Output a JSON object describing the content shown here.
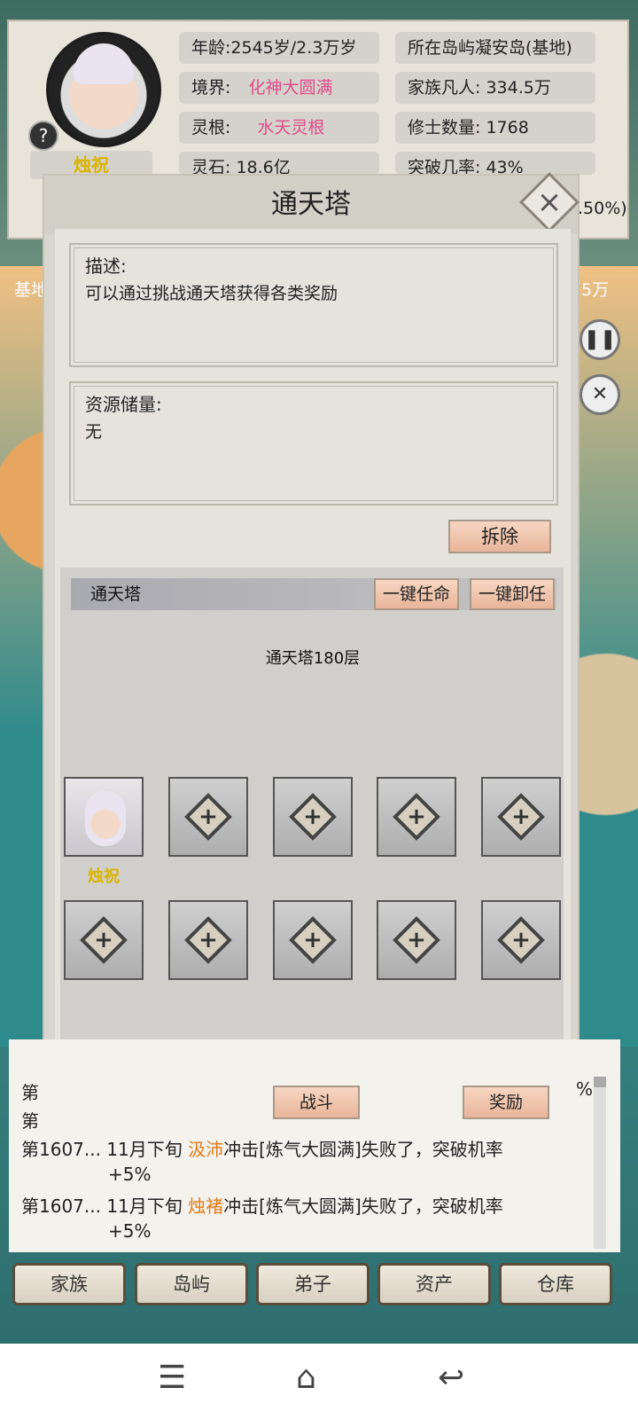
{
  "top": {
    "char_name": "烛祝",
    "help_icon": "?",
    "age": "年龄:2545岁/2.3万岁",
    "realm_label": "境界:",
    "realm_value": "化神大圆满",
    "root_label": "灵根:",
    "root_value": "水天灵根",
    "spirit_stone": "灵石:     18.6亿",
    "island": "所在岛屿凝安岛(基地)",
    "mortals": "家族凡人:   334.5万",
    "cultivators": "修士数量:     1768",
    "breakthrough": "突破几率:     43%",
    "partial_right": ".50%)"
  },
  "side": {
    "left_tag": "基地",
    "right_tag": "5万"
  },
  "modal": {
    "title": "通天塔",
    "close_icon": "×",
    "desc_label": "描述:",
    "desc_text": "可以通过挑战通天塔获得各类奖励",
    "res_label": "资源储量:",
    "res_text": "无",
    "demolish": "拆除",
    "building_name": "通天塔",
    "appoint_all": "一键任命",
    "dismiss_all": "一键卸任",
    "floor": "通天塔180层",
    "slot_name": "烛祝",
    "plus": "+",
    "fight": "战斗",
    "reward": "奖励"
  },
  "log": {
    "line1_prefix": "第1607...  11月下旬 ",
    "line1_who": "汲沛",
    "line1_rest": "冲击[炼气大圆满]失败了，突破机率",
    "line1_cont": "+5%",
    "line2_prefix": "第1607...  11月下旬 ",
    "line2_who": "烛褚",
    "line2_rest": "冲击[炼气大圆满]失败了，突破机率",
    "line2_cont": "+5%",
    "stub_a": "第",
    "stub_b": "第",
    "stub_pct": "%"
  },
  "nav": [
    "家族",
    "岛屿",
    "弟子",
    "资产",
    "仓库"
  ],
  "sys": {
    "menu": "☰",
    "home": "⌂",
    "back": "↩"
  }
}
